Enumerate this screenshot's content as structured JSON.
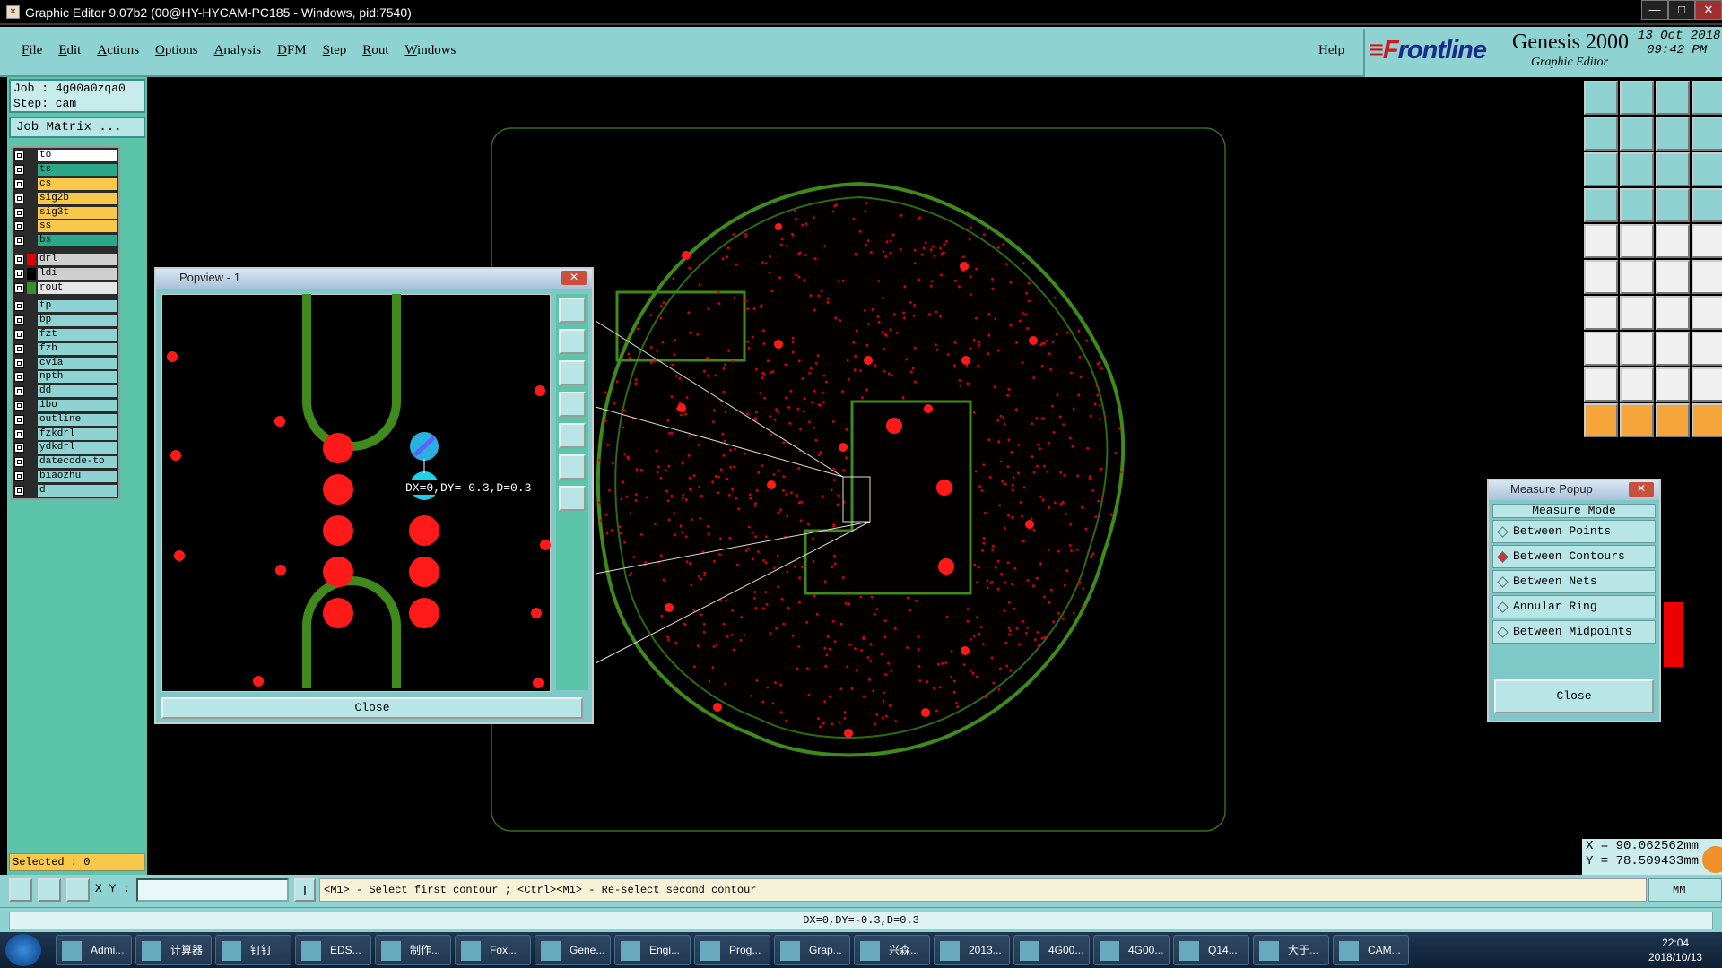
{
  "window": {
    "title": "Graphic Editor 9.07b2 (00@HY-HYCAM-PC185 - Windows, pid:7540)",
    "buttons": [
      "—",
      "□",
      "✕"
    ]
  },
  "menu": [
    "File",
    "Edit",
    "Actions",
    "Options",
    "Analysis",
    "DFM",
    "Step",
    "Rout",
    "Windows"
  ],
  "help": "Help",
  "brand": {
    "logo_prefix": "≡F",
    "logo_rest": "rontline",
    "product": "Genesis 2000",
    "subtitle": "Graphic Editor",
    "date": "13 Oct 2018",
    "time": "09:42 PM"
  },
  "job": {
    "job": "Job : 4g00a0zqa0",
    "step": "Step: cam",
    "matrix": "Job Matrix ..."
  },
  "layers_board": [
    {
      "name": "to",
      "color": "#ffffff"
    },
    {
      "name": "ts",
      "color": "#2aa88a"
    },
    {
      "name": "cs",
      "color": "#f7c84a"
    },
    {
      "name": "sig2b",
      "color": "#f7c84a"
    },
    {
      "name": "sig3t",
      "color": "#f7c84a"
    },
    {
      "name": "ss",
      "color": "#f7c84a"
    },
    {
      "name": "bs",
      "color": "#2aa88a"
    }
  ],
  "layers_drill": [
    {
      "name": "drl",
      "color": "#cfcfcf",
      "swatch": "#e00000"
    },
    {
      "name": "ldi",
      "color": "#cfcfcf",
      "swatch": "#000000"
    },
    {
      "name": "rout",
      "color": "#e6e6e6",
      "swatch": "#3a8f2a"
    }
  ],
  "layers_misc": [
    "tp",
    "bp",
    "fzt",
    "fzb",
    "cvia",
    "npth",
    "dd",
    "1bo",
    "outline",
    "fzkdrl",
    "ydkdrl",
    "datecode-to",
    "biaozhu",
    "d"
  ],
  "selected": "Selected : 0",
  "xy_label": "X Y :",
  "prompt": "<M1> - Select first contour ; <Ctrl><M1> - Re-select second contour",
  "units": "MM",
  "measure_result": "DX=0,DY=-0.3,D=0.3",
  "coords": {
    "x": "X = 90.062562mm",
    "y": "Y = 78.509433mm"
  },
  "popview": {
    "title": "Popview - 1",
    "close": "Close",
    "label": "DX=0,DY=-0.3,D=0.3"
  },
  "measure_popup": {
    "title": "Measure Popup",
    "header": "Measure Mode",
    "options": [
      "Between Points",
      "Between Contours",
      "Between Nets",
      "Annular Ring",
      "Between Midpoints"
    ],
    "selected": "Between Contours",
    "close": "Close"
  },
  "taskbar": [
    "Admi...",
    "计算器",
    "钉钉",
    "EDS...",
    "制作...",
    "Fox...",
    "Gene...",
    "Engi...",
    "Prog...",
    "Grap...",
    "兴森...",
    "2013...",
    "4G00...",
    "4G00...",
    "Q14...",
    "大于...",
    "CAM..."
  ],
  "clock": {
    "time": "22:04",
    "date": "2018/10/13"
  }
}
